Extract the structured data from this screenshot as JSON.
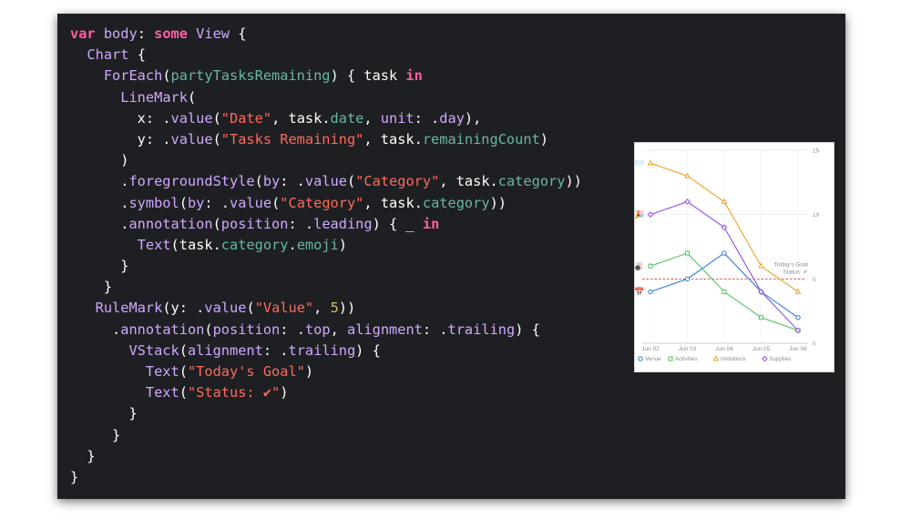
{
  "code_lines": [
    [
      [
        "kw",
        "var "
      ],
      [
        "typ",
        "body"
      ],
      [
        "pl",
        ": "
      ],
      [
        "kw",
        "some "
      ],
      [
        "typ",
        "View"
      ],
      [
        "pl",
        " {"
      ]
    ],
    [
      [
        "pl",
        "  "
      ],
      [
        "typ",
        "Chart"
      ],
      [
        "pl",
        " {"
      ]
    ],
    [
      [
        "pl",
        "    "
      ],
      [
        "typ",
        "ForEach"
      ],
      [
        "pl",
        "("
      ],
      [
        "fn",
        "partyTasksRemaining"
      ],
      [
        "pl",
        ") { task "
      ],
      [
        "kw",
        "in"
      ]
    ],
    [
      [
        "pl",
        "      "
      ],
      [
        "typ",
        "LineMark"
      ],
      [
        "pl",
        "("
      ]
    ],
    [
      [
        "pl",
        "        x: ."
      ],
      [
        "typ",
        "value"
      ],
      [
        "pl",
        "("
      ],
      [
        "str",
        "\"Date\""
      ],
      [
        "pl",
        ", task."
      ],
      [
        "fn",
        "date"
      ],
      [
        "pl",
        ", "
      ],
      [
        "typ",
        "unit"
      ],
      [
        "pl",
        ": ."
      ],
      [
        "typ",
        "day"
      ],
      [
        "pl",
        "),"
      ]
    ],
    [
      [
        "pl",
        "        y: ."
      ],
      [
        "typ",
        "value"
      ],
      [
        "pl",
        "("
      ],
      [
        "str",
        "\"Tasks Remaining\""
      ],
      [
        "pl",
        ", task."
      ],
      [
        "fn",
        "remainingCount"
      ],
      [
        "pl",
        ")"
      ]
    ],
    [
      [
        "pl",
        "      )"
      ]
    ],
    [
      [
        "pl",
        "      ."
      ],
      [
        "typ",
        "foregroundStyle"
      ],
      [
        "pl",
        "("
      ],
      [
        "typ",
        "by"
      ],
      [
        "pl",
        ": ."
      ],
      [
        "typ",
        "value"
      ],
      [
        "pl",
        "("
      ],
      [
        "str",
        "\"Category\""
      ],
      [
        "pl",
        ", task."
      ],
      [
        "fn",
        "category"
      ],
      [
        "pl",
        "))"
      ]
    ],
    [
      [
        "pl",
        "      ."
      ],
      [
        "typ",
        "symbol"
      ],
      [
        "pl",
        "("
      ],
      [
        "typ",
        "by"
      ],
      [
        "pl",
        ": ."
      ],
      [
        "typ",
        "value"
      ],
      [
        "pl",
        "("
      ],
      [
        "str",
        "\"Category\""
      ],
      [
        "pl",
        ", task."
      ],
      [
        "fn",
        "category"
      ],
      [
        "pl",
        "))"
      ]
    ],
    [
      [
        "pl",
        "      ."
      ],
      [
        "typ",
        "annotation"
      ],
      [
        "pl",
        "("
      ],
      [
        "typ",
        "position"
      ],
      [
        "pl",
        ": ."
      ],
      [
        "typ",
        "leading"
      ],
      [
        "pl",
        ") { _ "
      ],
      [
        "kw",
        "in"
      ]
    ],
    [
      [
        "pl",
        "        "
      ],
      [
        "typ",
        "Text"
      ],
      [
        "pl",
        "(task."
      ],
      [
        "fn",
        "category"
      ],
      [
        "pl",
        "."
      ],
      [
        "fn",
        "emoji"
      ],
      [
        "pl",
        ")"
      ]
    ],
    [
      [
        "pl",
        "      }"
      ]
    ],
    [
      [
        "pl",
        "    }"
      ]
    ],
    [
      [
        "pl",
        "   "
      ],
      [
        "typ",
        "RuleMark"
      ],
      [
        "pl",
        "(y: ."
      ],
      [
        "typ",
        "value"
      ],
      [
        "pl",
        "("
      ],
      [
        "str",
        "\"Value\""
      ],
      [
        "pl",
        ", "
      ],
      [
        "num",
        "5"
      ],
      [
        "pl",
        "))"
      ]
    ],
    [
      [
        "pl",
        "     ."
      ],
      [
        "typ",
        "annotation"
      ],
      [
        "pl",
        "("
      ],
      [
        "typ",
        "position"
      ],
      [
        "pl",
        ": ."
      ],
      [
        "typ",
        "top"
      ],
      [
        "pl",
        ", "
      ],
      [
        "typ",
        "alignment"
      ],
      [
        "pl",
        ": ."
      ],
      [
        "typ",
        "trailing"
      ],
      [
        "pl",
        ") {"
      ]
    ],
    [
      [
        "pl",
        "       "
      ],
      [
        "typ",
        "VStack"
      ],
      [
        "pl",
        "("
      ],
      [
        "typ",
        "alignment"
      ],
      [
        "pl",
        ": ."
      ],
      [
        "typ",
        "trailing"
      ],
      [
        "pl",
        ") {"
      ]
    ],
    [
      [
        "pl",
        "         "
      ],
      [
        "typ",
        "Text"
      ],
      [
        "pl",
        "("
      ],
      [
        "str",
        "\"Today's Goal\""
      ],
      [
        "pl",
        ")"
      ]
    ],
    [
      [
        "pl",
        "         "
      ],
      [
        "typ",
        "Text"
      ],
      [
        "pl",
        "("
      ],
      [
        "str",
        "\"Status: ✔\""
      ],
      [
        "pl",
        ")"
      ]
    ],
    [
      [
        "pl",
        "       }"
      ]
    ],
    [
      [
        "pl",
        "     }"
      ]
    ],
    [
      [
        "pl",
        "  }"
      ]
    ],
    [
      [
        "pl",
        "}"
      ]
    ]
  ],
  "colors": {
    "background": "#1e1f22",
    "keyword": "#fc5fa3",
    "type": "#d0a8ff",
    "function": "#67b7a4",
    "string": "#fc6a5d",
    "number": "#d0bf69"
  },
  "chart_data": {
    "type": "line",
    "categories": [
      "Jun 02",
      "Jun 03",
      "Jun 04",
      "Jun 05",
      "Jun 06"
    ],
    "ylim": [
      0,
      15
    ],
    "yticks": [
      "0",
      "5",
      "10",
      "15"
    ],
    "grid": true,
    "legend_position": "bottom-left",
    "series": [
      {
        "name": "Venue",
        "color": "#3e86d8",
        "symbol": "circle",
        "emoji": "📅",
        "values": [
          4,
          5,
          7,
          4,
          2
        ]
      },
      {
        "name": "Activities",
        "color": "#5cc76a",
        "symbol": "square",
        "emoji": "🎳",
        "values": [
          6,
          7,
          4,
          2,
          1
        ]
      },
      {
        "name": "Invitations",
        "color": "#f0a733",
        "symbol": "triangle",
        "emoji": "📨",
        "values": [
          14,
          13,
          11,
          6,
          4
        ]
      },
      {
        "name": "Supplies",
        "color": "#9b5de5",
        "symbol": "diamond",
        "emoji": "🎉",
        "values": [
          10,
          11,
          9,
          4,
          1
        ]
      }
    ],
    "rule": {
      "value": 5,
      "color": "#d9534f",
      "annotation": [
        "Today's Goal",
        "Status: ✔"
      ]
    }
  }
}
